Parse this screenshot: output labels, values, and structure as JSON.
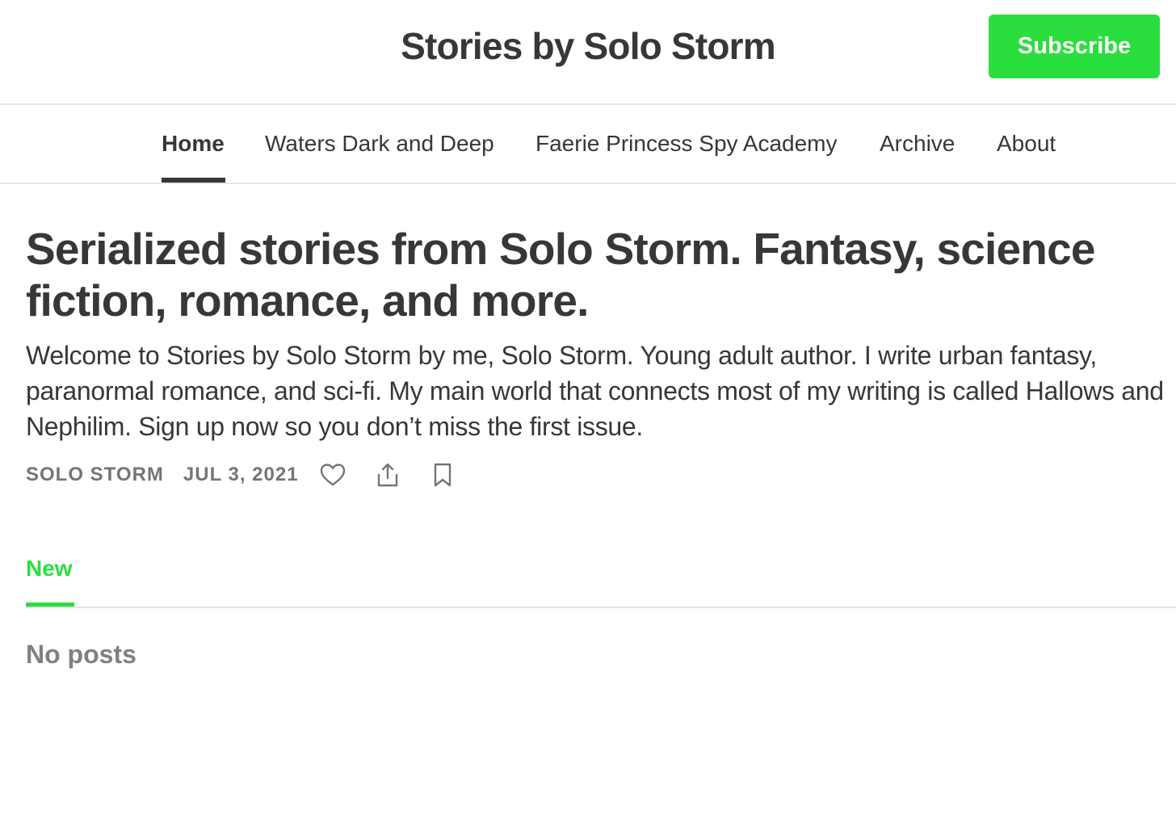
{
  "header": {
    "title": "Stories by Solo Storm",
    "subscribe_label": "Subscribe"
  },
  "nav": {
    "items": [
      {
        "label": "Home",
        "active": true
      },
      {
        "label": "Waters Dark and Deep",
        "active": false
      },
      {
        "label": "Faerie Princess Spy Academy",
        "active": false
      },
      {
        "label": "Archive",
        "active": false
      },
      {
        "label": "About",
        "active": false
      }
    ]
  },
  "post": {
    "headline": "Serialized stories from Solo Storm. Fantasy, science fiction, romance, and more.",
    "subtitle": "Welcome to Stories by Solo Storm by me, Solo Storm. Young adult author. I write urban fantasy, paranormal romance, and sci-fi. My main world that connects most of my writing is called Hallows and Nephilim. Sign up now so you don’t miss the first issue.",
    "author": "SOLO STORM",
    "date": "JUL 3, 2021",
    "icons": [
      "heart-icon",
      "share-icon",
      "bookmark-icon"
    ]
  },
  "feed": {
    "tab_label": "New",
    "empty_text": "No posts"
  },
  "colors": {
    "accent": "#2ade3d",
    "text": "#363737",
    "muted": "#757575"
  }
}
